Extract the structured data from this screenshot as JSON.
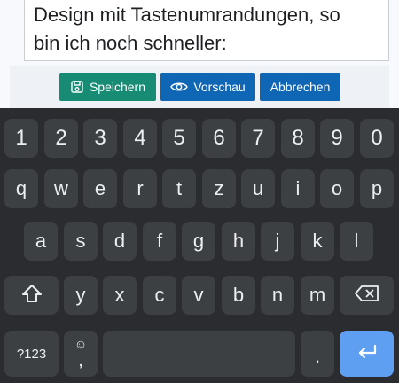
{
  "editor": {
    "lines": [
      "Design mit Tastenumrandungen, so",
      "bin ich noch schneller:"
    ]
  },
  "actions": {
    "save_label": "Speichern",
    "preview_label": "Vorschau",
    "cancel_label": "Abbrechen"
  },
  "keyboard": {
    "number_row": [
      "1",
      "2",
      "3",
      "4",
      "5",
      "6",
      "7",
      "8",
      "9",
      "0"
    ],
    "row1": [
      "q",
      "w",
      "e",
      "r",
      "t",
      "z",
      "u",
      "i",
      "o",
      "p"
    ],
    "row2": [
      "a",
      "s",
      "d",
      "f",
      "g",
      "h",
      "j",
      "k",
      "l"
    ],
    "row3": [
      "y",
      "x",
      "c",
      "v",
      "b",
      "n",
      "m"
    ],
    "symbols_label": "?123",
    "comma_label": ",",
    "period_label": "."
  },
  "colors": {
    "save_button": "#178b74",
    "preview_button": "#0f66b5",
    "cancel_button": "#0f66b5",
    "keyboard_bg": "#2a2c2f",
    "key_bg": "#3d4043",
    "enter_key": "#5e9ff2"
  }
}
